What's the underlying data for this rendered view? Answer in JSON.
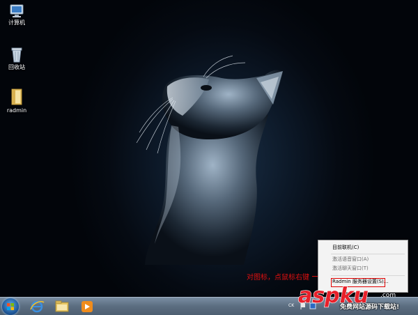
{
  "desktop": {
    "icons": [
      {
        "label": "计算机",
        "icon": "computer-icon"
      },
      {
        "label": "回收站",
        "icon": "recycle-bin-icon"
      },
      {
        "label": "radmin",
        "icon": "folder-icon"
      }
    ]
  },
  "context_menu": {
    "items": [
      {
        "label": "目前联机(C)",
        "enabled": true
      },
      {
        "label": "激活语音窗口(A)",
        "enabled": false
      },
      {
        "label": "激活聊天窗口(T)",
        "enabled": false
      },
      {
        "label": "Radmin 服务器设置(S)...",
        "enabled": true
      }
    ]
  },
  "annotation": {
    "text": "对图标，点鼠标右键",
    "color": "#e01010"
  },
  "taskbar": {
    "pinned": [
      "ie-icon",
      "explorer-icon",
      "media-player-icon"
    ],
    "tray_lang": "CK"
  },
  "watermark": {
    "logo": "aspku",
    "logo_suffix": ".com",
    "tagline": "免费网站源码下载站!"
  }
}
